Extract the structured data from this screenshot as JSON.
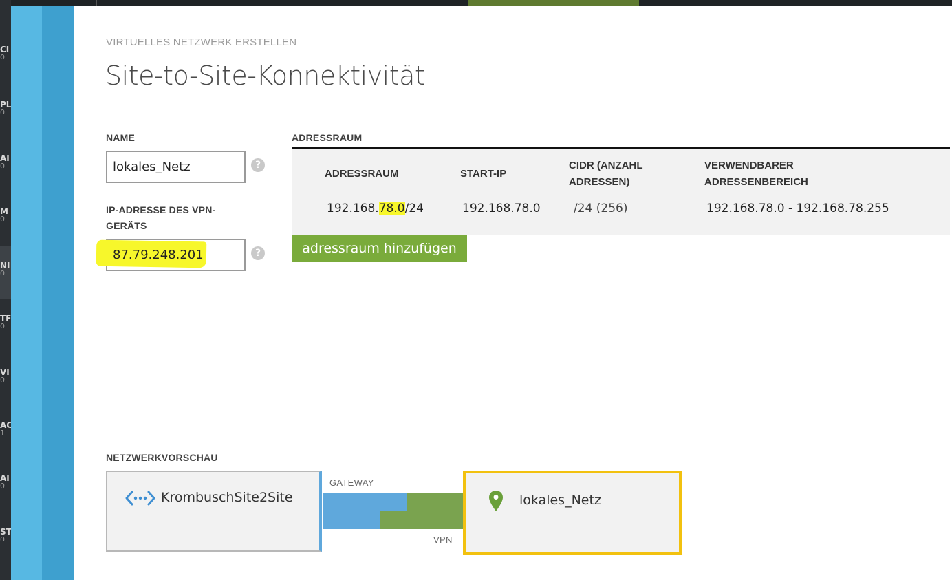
{
  "portal": {
    "nav_fragments": [
      {
        "label": "CI",
        "count": "0"
      },
      {
        "label": "PL",
        "count": "0"
      },
      {
        "label": "AI",
        "count": "0"
      },
      {
        "label": "M",
        "count": "0"
      },
      {
        "label": "NI",
        "count": "0"
      },
      {
        "label": "TF",
        "count": "0"
      },
      {
        "label": "VI",
        "count": "0"
      },
      {
        "label": "AC",
        "count": "1"
      },
      {
        "label": "AI",
        "count": "0"
      },
      {
        "label": "ST",
        "count": "0"
      }
    ]
  },
  "wizard": {
    "subtitle": "VIRTUELLES NETZWERK ERSTELLEN",
    "title": "Site-to-Site-Konnektivität"
  },
  "form": {
    "name_label": "NAME",
    "name_value": "lokales_Netz",
    "vpn_label_line1": "IP-ADRESSE DES VPN-",
    "vpn_label_line2": "GERÄTS",
    "vpn_value": "87.79.248.201",
    "help_glyph": "?"
  },
  "address_space": {
    "section_label": "ADRESSRAUM",
    "columns": {
      "adressraum": "ADRESSRAUM",
      "start_ip": "START-IP",
      "cidr_line1": "CIDR (ANZAHL",
      "cidr_line2": "ADRESSEN)",
      "range_line1": "VERWENDBARER",
      "range_line2": "ADRESSENBEREICH"
    },
    "row": {
      "adressraum_a": "192.168.",
      "adressraum_hl": "78.0",
      "adressraum_b": "/24",
      "start_ip": "192.168.78.0",
      "cidr": "/24 (256)",
      "range": "192.168.78.0 - 192.168.78.255"
    },
    "add_button": "adressraum hinzufügen"
  },
  "preview": {
    "section_label": "NETZWERKVORSCHAU",
    "cloud_network": "KrombuschSite2Site",
    "gateway_label": "GATEWAY",
    "vpn_label": "VPN",
    "local_network": "lokales_Netz"
  },
  "colors": {
    "accent_green": "#7aab3b",
    "accent_blue": "#5fa8dc",
    "highlight_yellow": "#f7f72b",
    "selected_border": "#f2c10f"
  }
}
